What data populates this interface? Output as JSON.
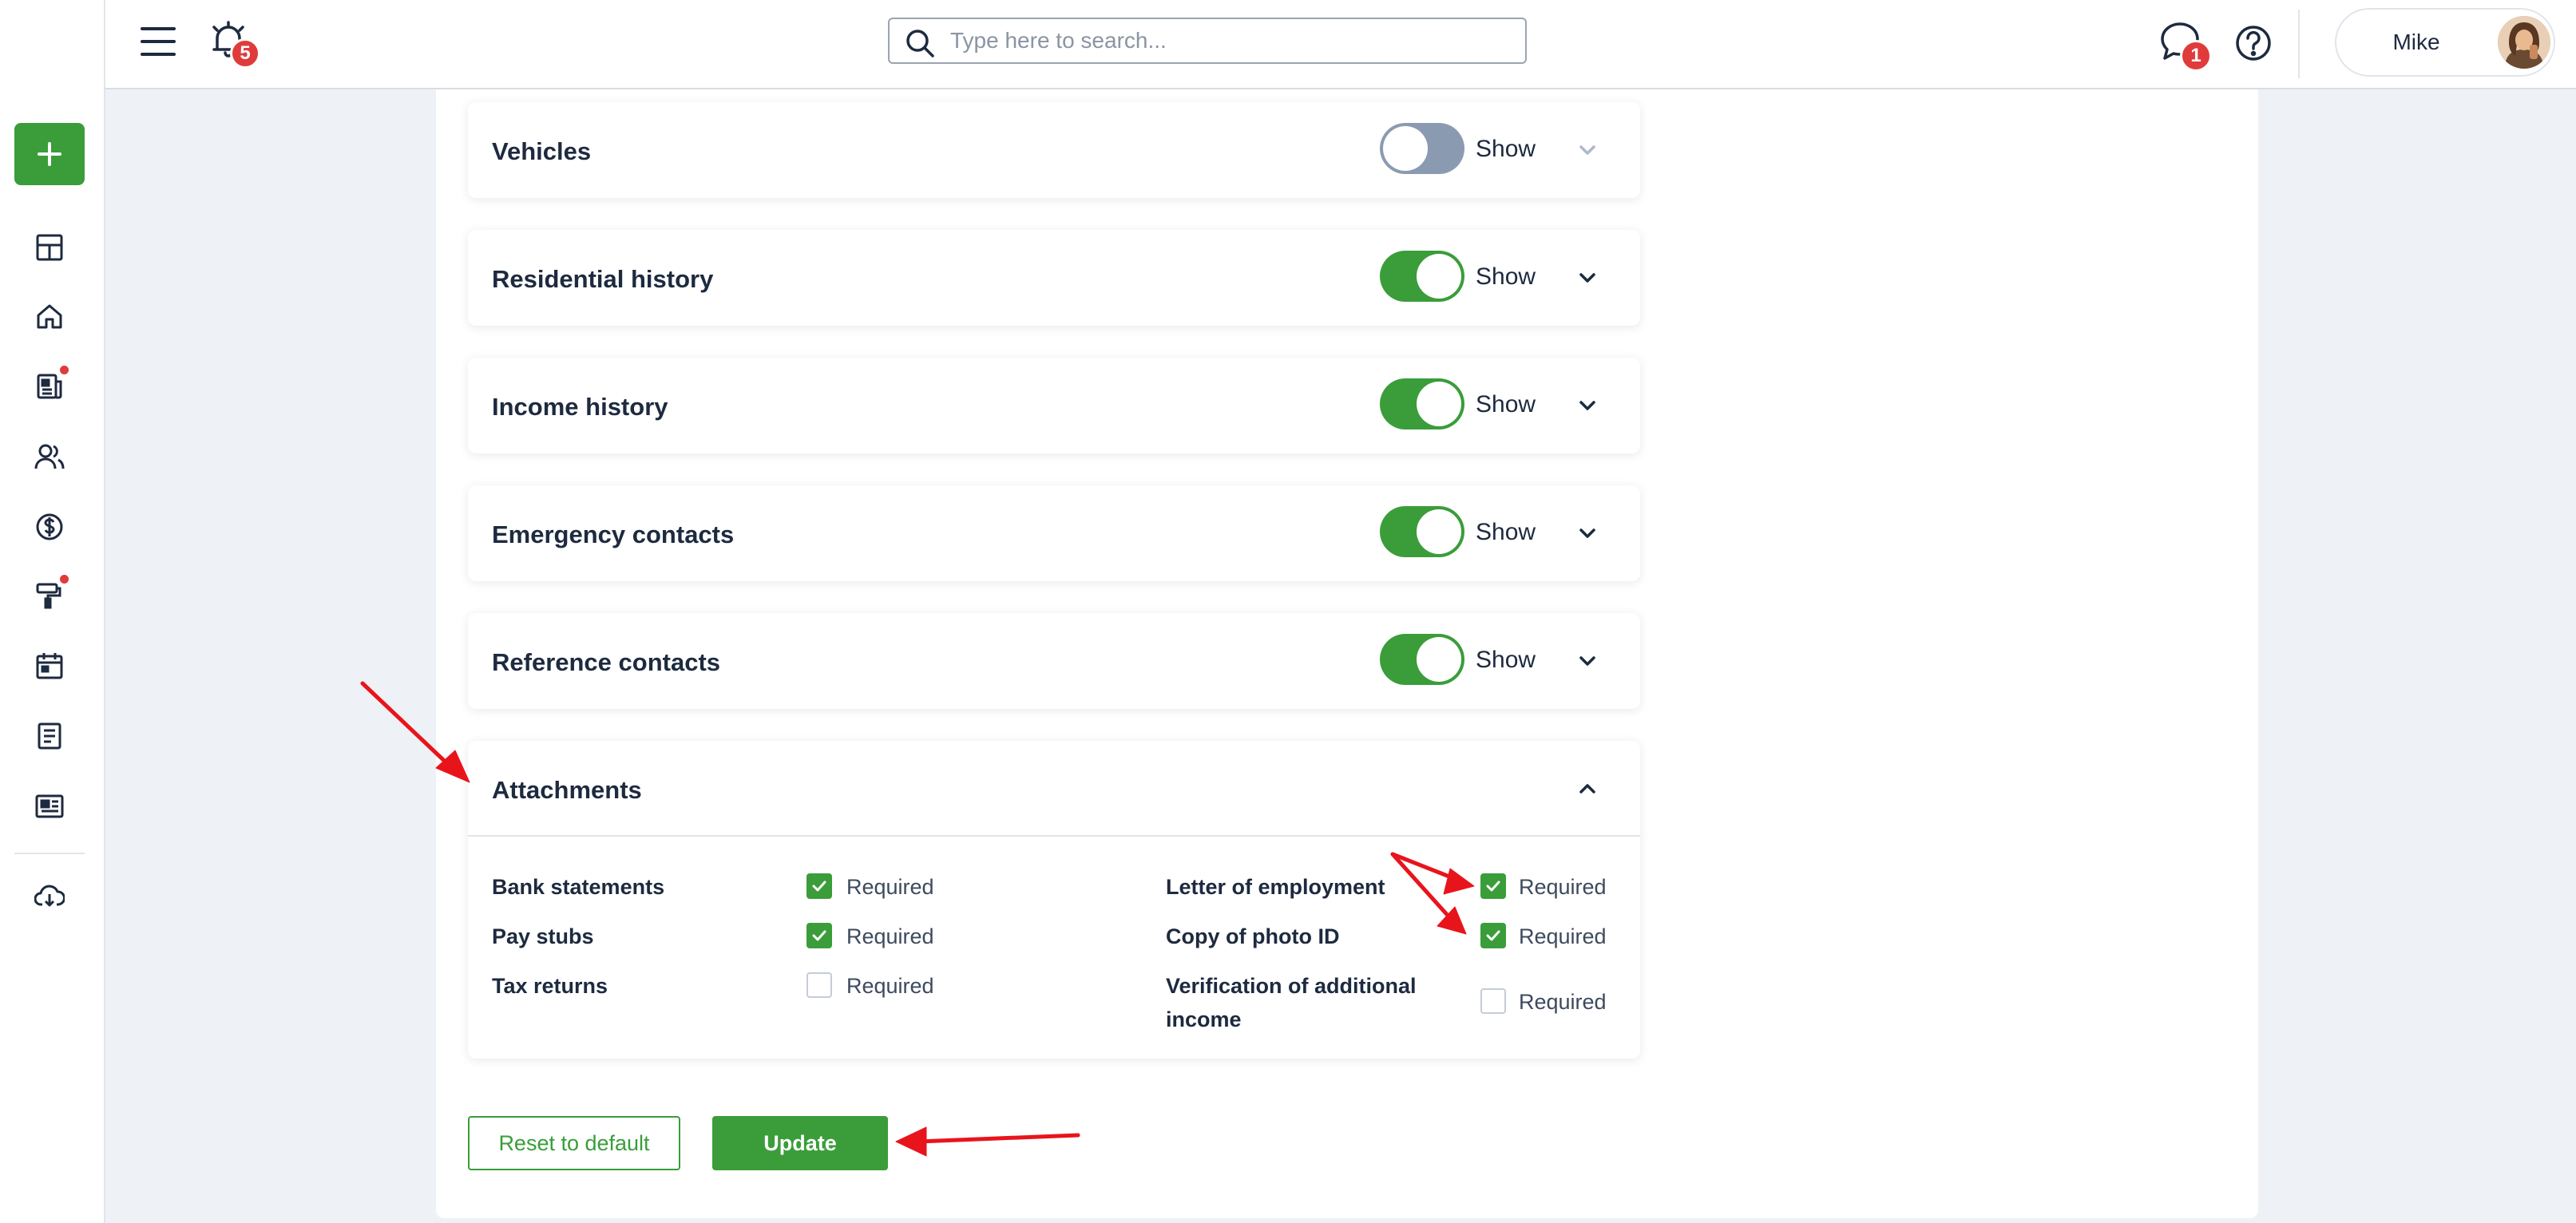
{
  "topbar": {
    "notifications_count": "5",
    "search_placeholder": "Type here to search...",
    "messages_count": "1",
    "user_name": "Mike"
  },
  "sidebar": {
    "items": [
      {
        "icon": "dashboard-icon"
      },
      {
        "icon": "home-icon"
      },
      {
        "icon": "leases-icon",
        "dot": true
      },
      {
        "icon": "people-icon"
      },
      {
        "icon": "dollar-icon"
      },
      {
        "icon": "maintenance-icon",
        "dot": true
      },
      {
        "icon": "calendar-icon"
      },
      {
        "icon": "document-icon"
      },
      {
        "icon": "listing-icon"
      },
      {
        "icon": "download-icon"
      }
    ]
  },
  "sections": [
    {
      "title": "Vehicles",
      "toggle": "off",
      "show_label": "Show"
    },
    {
      "title": "Residential history",
      "toggle": "on",
      "show_label": "Show"
    },
    {
      "title": "Income history",
      "toggle": "on",
      "show_label": "Show"
    },
    {
      "title": "Emergency contacts",
      "toggle": "on",
      "show_label": "Show"
    },
    {
      "title": "Reference contacts",
      "toggle": "on",
      "show_label": "Show"
    }
  ],
  "attachments": {
    "title": "Attachments",
    "required_label": "Required",
    "left": [
      {
        "label": "Bank statements",
        "checked": true
      },
      {
        "label": "Pay stubs",
        "checked": true
      },
      {
        "label": "Tax returns",
        "checked": false
      }
    ],
    "right": [
      {
        "label": "Letter of employment",
        "checked": true
      },
      {
        "label": "Copy of photo ID",
        "checked": true
      },
      {
        "label": "Verification of additional income",
        "checked": false
      }
    ]
  },
  "buttons": {
    "reset": "Reset to default",
    "update": "Update"
  },
  "colors": {
    "accent": "#3a9d3a",
    "badge": "#e03b3b",
    "toggle_off": "#8a9bb1",
    "annotation": "#e8141c"
  }
}
